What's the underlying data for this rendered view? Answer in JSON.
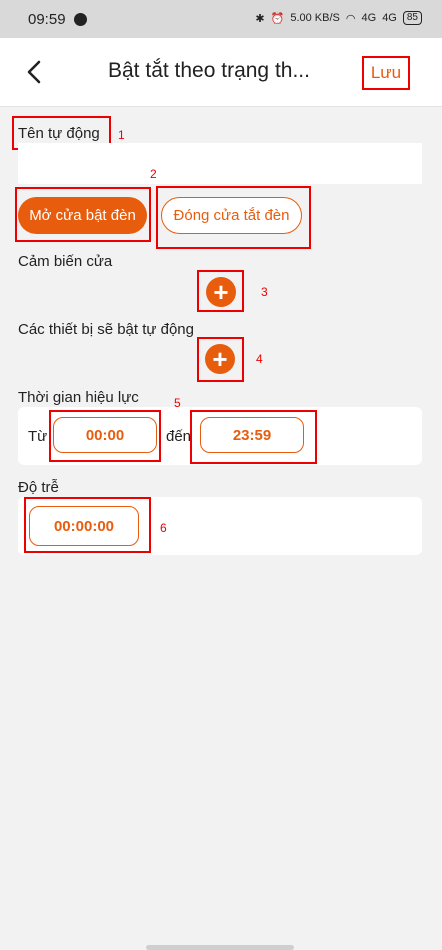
{
  "status": {
    "time": "09:59",
    "icons": [
      "bluetooth-icon",
      "alarm-icon"
    ],
    "net_speed": "5.00 KB/S",
    "signal1": "4G",
    "signal2": "4G",
    "battery": "85"
  },
  "header": {
    "title": "Bật tắt theo trạng th...",
    "save_label": "Lưu"
  },
  "form": {
    "name_label": "Tên tự động",
    "name_value": "",
    "modes": [
      "Mở cửa bật đèn",
      "Đóng cửa tắt đèn"
    ],
    "sensor_label": "Cảm biến cửa",
    "devices_label": "Các thiết bị sẽ bật tự động",
    "validity_label": "Thời gian hiệu lực",
    "from_label": "Từ",
    "from_time": "00:00",
    "to_label": "đến",
    "to_time": "23:59",
    "delay_label": "Độ trễ",
    "delay_value": "00:00:00"
  },
  "annotations": [
    "1",
    "2",
    "3",
    "4",
    "5",
    "6"
  ],
  "colors": {
    "accent": "#e85c0d",
    "highlight": "#ee0000",
    "background": "#f2f2f2"
  }
}
